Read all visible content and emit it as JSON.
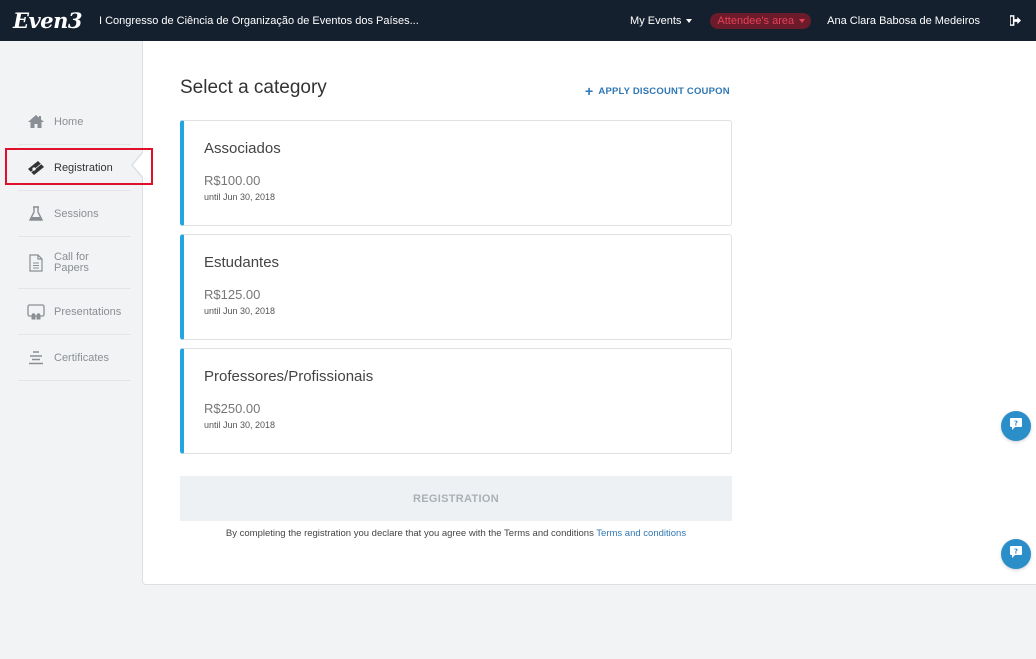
{
  "header": {
    "logo": "Even3",
    "event_title": "I Congresso de Ciência de Organização de Eventos dos Países...",
    "my_events": "My Events",
    "attendee_area": "Attendee's area",
    "user_name": "Ana Clara Babosa de Medeiros"
  },
  "sidebar": {
    "items": [
      {
        "label": "Home",
        "icon": "home-icon"
      },
      {
        "label": "Registration",
        "icon": "ticket-icon",
        "active": true
      },
      {
        "label": "Sessions",
        "icon": "flask-icon"
      },
      {
        "label_line1": "Call for",
        "label_line2": "Papers",
        "icon": "document-icon"
      },
      {
        "label": "Presentations",
        "icon": "presentation-icon"
      },
      {
        "label": "Certificates",
        "icon": "certificate-icon"
      }
    ]
  },
  "main": {
    "title": "Select a category",
    "coupon_label": "APPLY DISCOUNT COUPON",
    "categories": [
      {
        "name": "Associados",
        "price": "R$100.00",
        "until": "until Jun 30, 2018"
      },
      {
        "name": "Estudantes",
        "price": "R$125.00",
        "until": "until Jun 30, 2018"
      },
      {
        "name": "Professores/Profissionais",
        "price": "R$250.00",
        "until": "until Jun 30, 2018"
      }
    ],
    "register_button": "REGISTRATION",
    "terms_text": "By completing the registration you declare that you agree with the Terms and conditions",
    "terms_link": "Terms and conditions"
  },
  "colors": {
    "topbar": "#15202f",
    "accent": "#23a6e0",
    "link": "#2f77b3",
    "highlight": "#e0102a"
  }
}
